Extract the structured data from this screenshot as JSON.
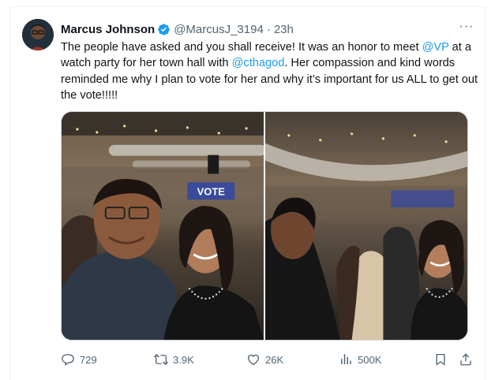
{
  "tweet": {
    "author_name": "Marcus Johnson",
    "handle": "@MarcusJ_3194",
    "separator": "·",
    "time": "23h",
    "more_label": "···",
    "text_parts": {
      "p1": "The people have asked and you shall receive! It was an honor to meet ",
      "m1": "@VP",
      "p2": " at a watch party for her town hall with ",
      "m2": "@cthagod",
      "p3": ". Her compassion and kind words reminded me why I plan to vote for her and why it’s important for us ALL to get out the vote!!!!!"
    },
    "sign_text": "VOTE"
  },
  "actions": {
    "replies": "729",
    "reposts": "3.9K",
    "likes": "26K",
    "views": "500K"
  },
  "icons": {
    "verified": "verified-badge-icon",
    "reply": "reply-icon",
    "repost": "repost-icon",
    "like": "heart-icon",
    "views": "views-chart-icon",
    "bookmark": "bookmark-icon",
    "share": "share-icon"
  },
  "colors": {
    "accent": "#1d9bf0",
    "muted": "#536471",
    "text": "#0f1419"
  }
}
